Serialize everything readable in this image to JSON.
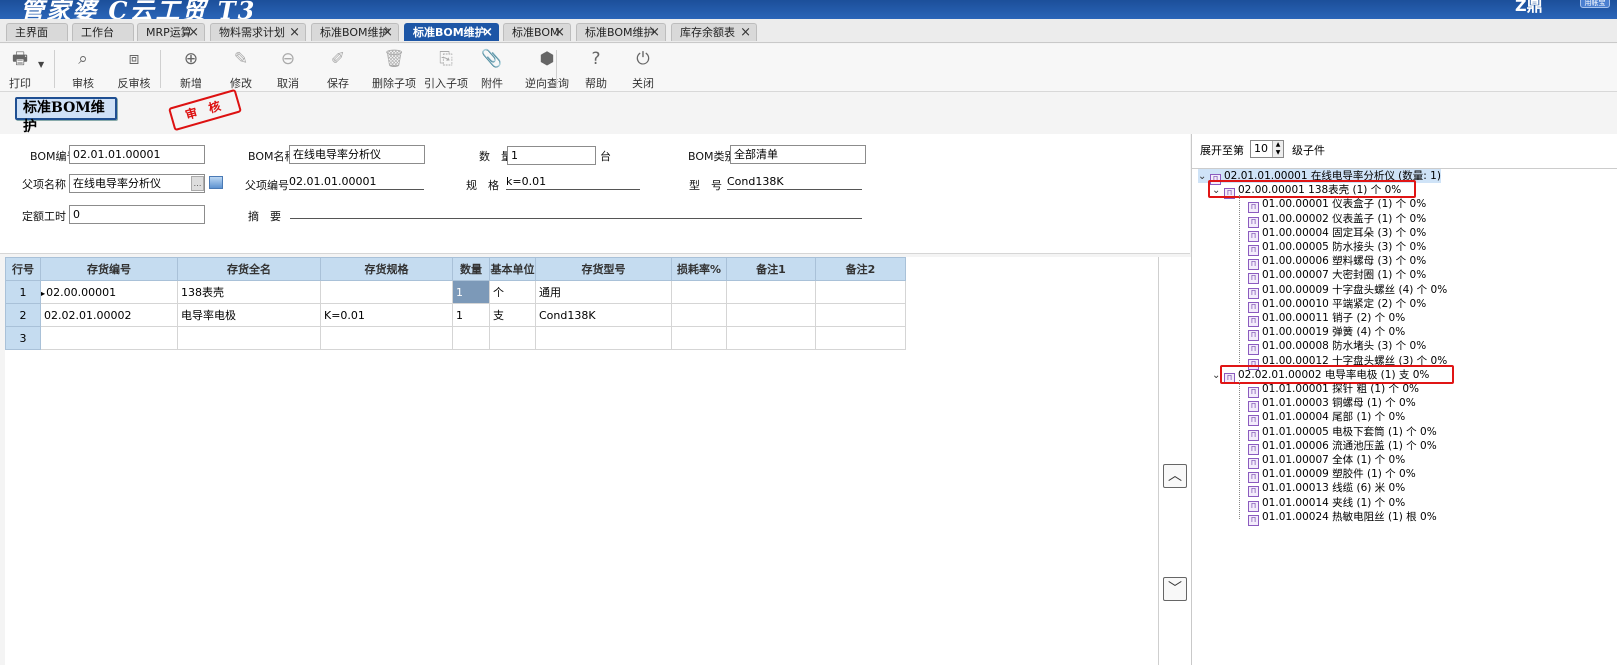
{
  "banner": {
    "brand": "管家婆 C云工贸 T3",
    "user": "Z鼎",
    "pill": "用帐宝"
  },
  "tabs": [
    {
      "label": "主界面",
      "closable": false
    },
    {
      "label": "工作台",
      "closable": false
    },
    {
      "label": "MRP运算",
      "closable": true
    },
    {
      "label": "物料需求计划",
      "closable": true
    },
    {
      "label": "标准BOM维护",
      "closable": true
    },
    {
      "label": "标准BOM维护",
      "closable": true,
      "active": true
    },
    {
      "label": "标准BOM",
      "closable": true
    },
    {
      "label": "标准BOM维护",
      "closable": true
    },
    {
      "label": "库存余额表",
      "closable": true
    }
  ],
  "toolbar": [
    {
      "label": "打印",
      "icon": "printer-icon",
      "glyph": "🖶"
    },
    {
      "label": "审核",
      "icon": "search-icon",
      "glyph": "⌕"
    },
    {
      "label": "反审核",
      "icon": "zoom-box-icon",
      "glyph": "⧈"
    },
    {
      "label": "新增",
      "icon": "plus-circle-icon",
      "glyph": "⊕"
    },
    {
      "label": "修改",
      "icon": "edit-icon",
      "glyph": "✎"
    },
    {
      "label": "取消",
      "icon": "minus-circle-icon",
      "glyph": "⊖"
    },
    {
      "label": "保存",
      "icon": "brush-icon",
      "glyph": "✐"
    },
    {
      "label": "删除子项",
      "icon": "trash-icon",
      "glyph": "🗑"
    },
    {
      "label": "引入子项",
      "icon": "import-icon",
      "glyph": "⎘"
    },
    {
      "label": "附件",
      "icon": "paperclip-icon",
      "glyph": "📎"
    },
    {
      "label": "逆向查询",
      "icon": "cube-icon",
      "glyph": "⬢"
    },
    {
      "label": "帮助",
      "icon": "help-icon",
      "glyph": "?"
    },
    {
      "label": "关闭",
      "icon": "power-icon",
      "glyph": "⏻"
    }
  ],
  "page_title": "标准BOM维护",
  "stamp": "审 核",
  "form": {
    "bom_no_label": "BOM编号",
    "bom_no": "02.01.01.00001",
    "bom_name_label": "BOM名称",
    "bom_name": "在线电导率分析仪",
    "qty_label": "数　量",
    "qty": "1",
    "qty_unit": "台",
    "bom_type_label": "BOM类别",
    "bom_type": "全部清单",
    "parent_name_label": "父项名称",
    "parent_name": "在线电导率分析仪",
    "parent_code_label": "父项编号",
    "parent_code": "02.01.01.00001",
    "spec_label": "规　格",
    "spec": "k=0.01",
    "model_label": "型　号",
    "model": "Cond138K",
    "work_hours_label": "定额工时",
    "work_hours": "0",
    "summary_label": "摘　要",
    "summary": ""
  },
  "grid": {
    "columns": [
      "行号",
      "存货编号",
      "存货全名",
      "存货规格",
      "数量",
      "基本单位",
      "存货型号",
      "损耗率%",
      "备注1",
      "备注2"
    ],
    "rows": [
      [
        "1",
        "02.00.00001",
        "138表壳",
        "",
        "1",
        "个",
        "通用",
        "",
        "",
        ""
      ],
      [
        "2",
        "02.02.01.00002",
        "电导率电极",
        "K=0.01",
        "1",
        "支",
        "Cond138K",
        "",
        "",
        ""
      ],
      [
        "3",
        "",
        "",
        "",
        "",
        "",
        "",
        "",
        "",
        ""
      ]
    ]
  },
  "tree": {
    "expand_label": "展开至第",
    "expand_level": "10",
    "expand_suffix": "级子件",
    "root": "02.01.01.00001 在线电导率分析仪 (数量: 1)",
    "groups": [
      {
        "label": "02.00.00001 138表壳 (1) 个 0%",
        "children": [
          "01.00.00001 仪表盒子 (1) 个 0%",
          "01.00.00002 仪表盖子 (1) 个 0%",
          "01.00.00004 固定耳朵 (3) 个 0%",
          "01.00.00005 防水接头 (3) 个 0%",
          "01.00.00006 塑料螺母 (3) 个 0%",
          "01.00.00007 大密封圈 (1) 个 0%",
          "01.00.00009 十字盘头螺丝 (4) 个 0%",
          "01.00.00010 平端紧定 (2) 个 0%",
          "01.00.00011 销子 (2) 个 0%",
          "01.00.00019 弹簧 (4) 个 0%",
          "01.00.00008 防水堵头 (3) 个 0%",
          "01.00.00012 十字盘头螺丝 (3) 个 0%"
        ]
      },
      {
        "label": "02.02.01.00002 电导率电极 (1) 支 0%",
        "children": [
          "01.01.00001 探针 粗 (1) 个 0%",
          "01.01.00003 铜螺母 (1) 个 0%",
          "01.01.00004 尾部 (1) 个 0%",
          "01.01.00005 电极下套筒 (1) 个 0%",
          "01.01.00006 流通池压盖 (1) 个 0%",
          "01.01.00007 全体 (1) 个 0%",
          "01.01.00009 塑胶件 (1) 个 0%",
          "01.01.00013 线缆 (6) 米 0%",
          "01.01.00014 夹线 (1) 个 0%",
          "01.01.00024 热敏电阻丝 (1) 根 0%"
        ]
      }
    ]
  }
}
